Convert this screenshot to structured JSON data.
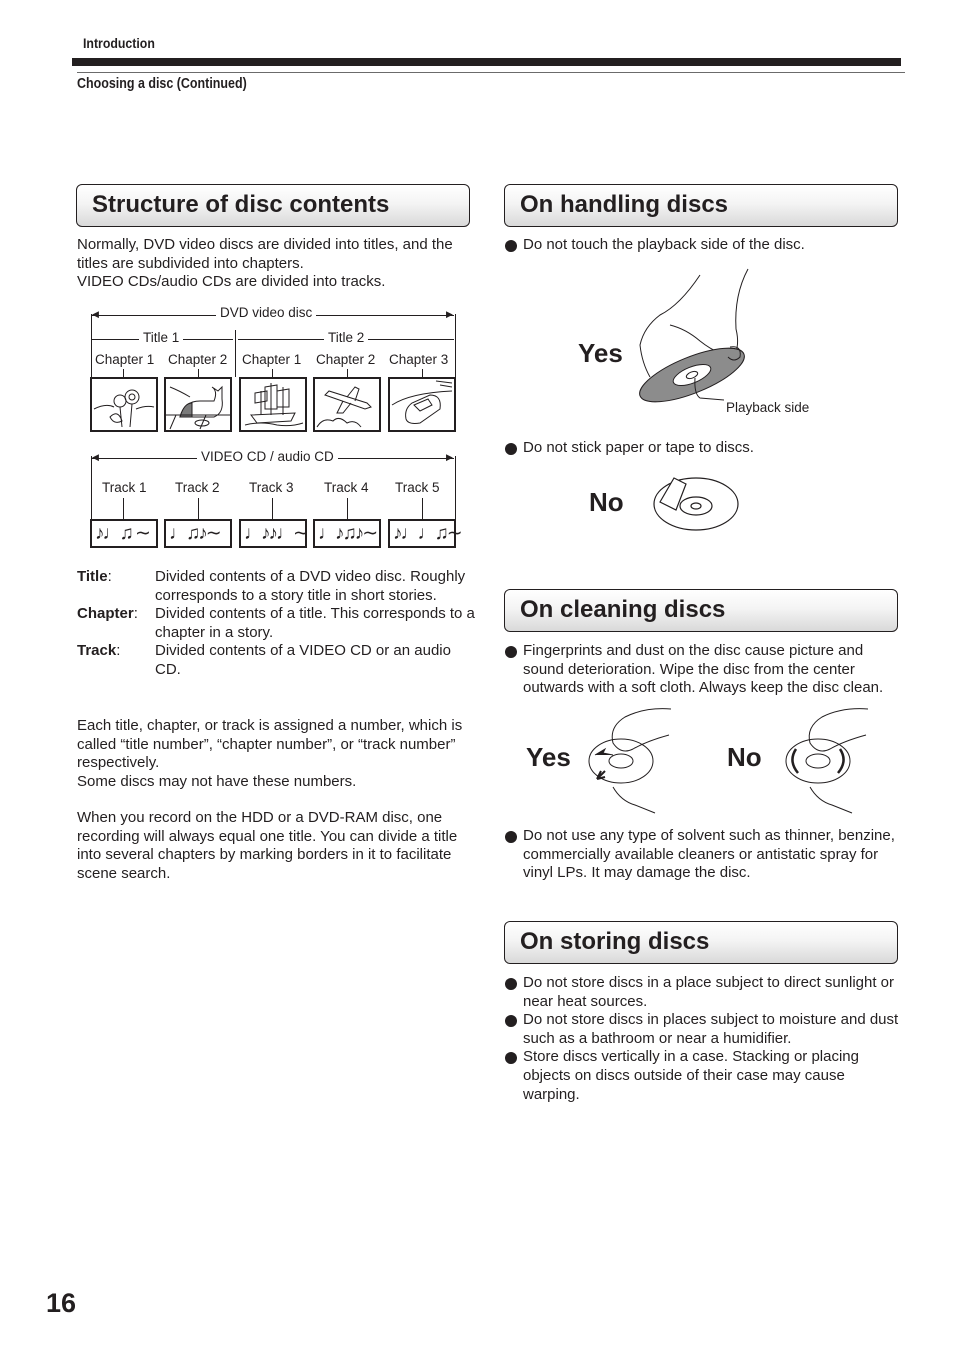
{
  "header": {
    "section": "Introduction",
    "subsection": "Choosing a disc (Continued)"
  },
  "structure": {
    "heading": "Structure of disc contents",
    "intro": [
      "Normally, DVD video discs are divided into titles, and the titles are subdivided into chapters.",
      "VIDEO CDs/audio CDs are divided into tracks."
    ],
    "dvd_diagram": {
      "disc_label": "DVD video disc",
      "titles": [
        "Title 1",
        "Title 2"
      ],
      "chapters": [
        "Chapter 1",
        "Chapter 2",
        "Chapter 1",
        "Chapter 2",
        "Chapter 3"
      ],
      "thumbnails": [
        "sunflowers-icon",
        "cat-icon",
        "sailing-ship-icon",
        "airplane-icon",
        "car-icon"
      ]
    },
    "cd_diagram": {
      "disc_label": "VIDEO CD / audio CD",
      "tracks": [
        "Track 1",
        "Track 2",
        "Track 3",
        "Track 4",
        "Track 5"
      ],
      "notes": [
        "♪♩♫ ∼",
        "♩♫♪∼",
        "♩♪♪♩∼",
        "♩♪♫♪∼",
        "♪♩♩♫∼"
      ]
    },
    "definitions": [
      {
        "term": "Title",
        "desc": "Divided contents of a DVD video disc. Roughly corresponds to a story title in short stories."
      },
      {
        "term": "Chapter",
        "desc": "Divided contents of a title. This corresponds to a chapter in a story."
      },
      {
        "term": "Track",
        "desc": "Divided contents of a VIDEO CD or an audio CD."
      }
    ],
    "para1": [
      "Each title, chapter, or track is assigned a number, which is called “title number”, “chapter number”, or “track number” respectively.",
      "Some discs may not have these numbers."
    ],
    "para2": "When you record on the HDD or a DVD-RAM disc, one recording will always equal one title. You can divide a title into several chapters by marking borders in it to facilitate scene search."
  },
  "handling": {
    "heading": "On handling discs",
    "bullet1": "Do not touch the playback side of the disc.",
    "yes_label": "Yes",
    "playback_side_label": "Playback side",
    "bullet2": "Do not stick paper or tape to discs.",
    "no_label": "No"
  },
  "cleaning": {
    "heading": "On cleaning discs",
    "bullet1": "Fingerprints and dust on the disc cause picture and sound deterioration. Wipe the disc from the center outwards with a soft cloth. Always keep the disc clean.",
    "yes_label": "Yes",
    "no_label": "No",
    "bullet2": "Do not use any type of solvent such as thinner, benzine, commercially available cleaners or antistatic spray for vinyl LPs. It may damage the disc."
  },
  "storing": {
    "heading": "On storing discs",
    "bullets": [
      "Do not store discs in a place subject to direct sunlight or near heat sources.",
      "Do not store discs in places subject to moisture and dust such as a bathroom or near a humidifier.",
      "Store discs vertically in a case. Stacking or placing objects on discs outside of their case may cause warping."
    ]
  },
  "page_number": "16"
}
